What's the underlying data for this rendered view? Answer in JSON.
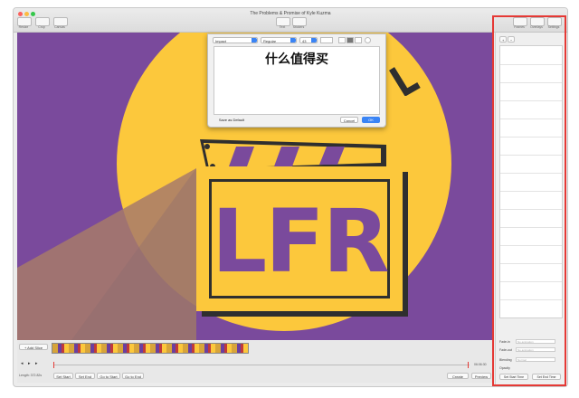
{
  "window": {
    "title": "The Problems & Promise of Kyle Kuzma",
    "toolbar_left": [
      "Resize",
      "Crop",
      "Canvas"
    ],
    "toolbar_center": [
      "Text",
      "Stickers"
    ],
    "toolbar_right": [
      "Frames",
      "Overlays",
      "Settings"
    ]
  },
  "canvas": {
    "logo_text": "LFR",
    "colors": {
      "purple": "#7a4a9c",
      "yellow": "#fcc83c",
      "dark": "#2f2f2f"
    }
  },
  "text_dialog": {
    "font": "Impact",
    "style": "Regular",
    "size": "43",
    "text": "什么值得买",
    "save_default_label": "Save as Default",
    "cancel_label": "Cancel",
    "ok_label": "OK"
  },
  "timeline": {
    "add_slice_label": "+ Add Slice",
    "length": "Length: 372.82s",
    "time": "06:06:30",
    "buttons": [
      "Set Start",
      "Set End",
      "Go to Start",
      "Go to End"
    ],
    "create_label": "Create",
    "preview_label": "Preview"
  },
  "sidebar": {
    "fade_in": "Fade-in",
    "fade_out": "Fade-out",
    "blending": "Blending",
    "blending_value": "Normal",
    "opacity": "Opacity",
    "set_start_time": "Set Start Time",
    "set_end_time": "Set End Time",
    "fade_placeholder": "No animation"
  }
}
